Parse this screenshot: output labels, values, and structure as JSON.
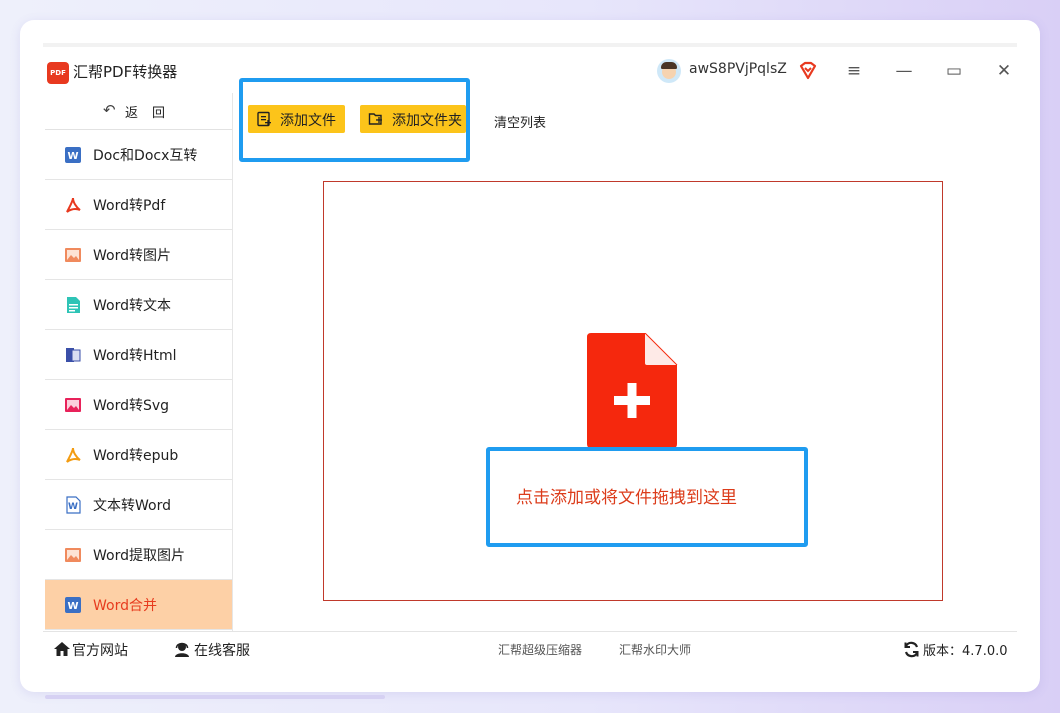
{
  "app": {
    "title": "汇帮PDF转换器",
    "logo_text": "PDF"
  },
  "user": {
    "name": "awS8PVjPqlsZ"
  },
  "window_controls": {
    "menu": "≡",
    "minimize": "—",
    "maximize": "▭",
    "close": "✕"
  },
  "sidebar": {
    "back_label": "返回",
    "items": [
      {
        "label": "Doc和Docx互转",
        "icon": "word-icon"
      },
      {
        "label": "Word转Pdf",
        "icon": "pdf-icon"
      },
      {
        "label": "Word转图片",
        "icon": "image-icon"
      },
      {
        "label": "Word转文本",
        "icon": "text-doc-icon"
      },
      {
        "label": "Word转Html",
        "icon": "html-icon"
      },
      {
        "label": "Word转Svg",
        "icon": "svg-image-icon"
      },
      {
        "label": "Word转epub",
        "icon": "epub-icon"
      },
      {
        "label": "文本转Word",
        "icon": "word-outline-icon"
      },
      {
        "label": "Word提取图片",
        "icon": "image-icon"
      },
      {
        "label": "Word合并",
        "icon": "word-icon",
        "active": true
      }
    ]
  },
  "toolbar": {
    "add_file": "添加文件",
    "add_folder": "添加文件夹",
    "clear_list": "清空列表"
  },
  "dropzone": {
    "hint": "点击添加或将文件拖拽到这里"
  },
  "bottombar": {
    "website": "官方网站",
    "support": "在线客服",
    "compressor": "汇帮超级压缩器",
    "watermark": "汇帮水印大师",
    "version_label": "版本：",
    "version_value": "4.7.0.0"
  },
  "colors": {
    "accent_yellow": "#fcc41a",
    "active_item_bg": "#fdd0a6",
    "active_item_text": "#e73c1f",
    "highlight_blue": "#1f9cf0",
    "dropzone_border": "#c0392b",
    "file_icon_red": "#f5280d"
  }
}
